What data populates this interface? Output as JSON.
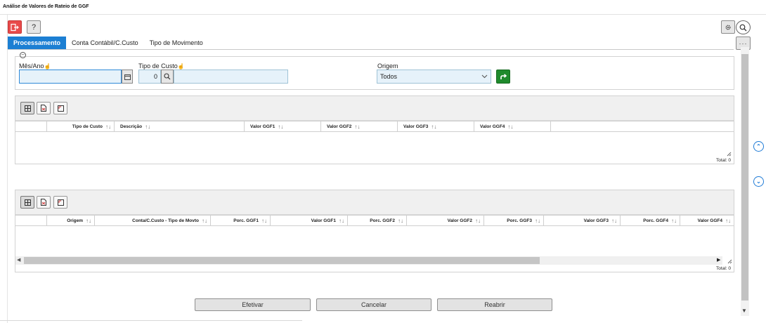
{
  "window": {
    "title": "Análise de Valores de Rateio de GGF"
  },
  "toolbar": {
    "exit_icon": "exit-icon",
    "help_label": "?",
    "more_label": "···"
  },
  "tabs": [
    {
      "label": "Processamento",
      "active": true
    },
    {
      "label": "Conta Contábil/C.Custo",
      "active": false
    },
    {
      "label": "Tipo de Movimento",
      "active": false
    }
  ],
  "filters": {
    "mes_ano": {
      "label": "Mês/Ano",
      "value": ""
    },
    "tipo_custo": {
      "label": "Tipo de Custo",
      "value": "0",
      "description": ""
    },
    "origem": {
      "label": "Origem",
      "value": "Todos"
    }
  },
  "grid1": {
    "columns": [
      "Tipo de Custo",
      "Descrição",
      "Valor GGF1",
      "Valor GGF2",
      "Valor GGF3",
      "Valor GGF4"
    ],
    "rows": [],
    "total_label": "Total: 0"
  },
  "grid2": {
    "columns": [
      "Origem",
      "Conta/C.Custo - Tipo de Movto",
      "Porc. GGF1",
      "Valor GGF1",
      "Porc. GGF2",
      "Valor GGF2",
      "Porc. GGF3",
      "Valor GGF3",
      "Porc. GGF4",
      "Valor GGF4"
    ],
    "rows": [],
    "total_label": "Total: 0"
  },
  "actions": {
    "efetivar": "Efetivar",
    "cancelar": "Cancelar",
    "reabrir": "Reabrir"
  },
  "colors": {
    "accent": "#1c7fd3",
    "exit": "#e84b4b",
    "go": "#1f8a2c"
  }
}
